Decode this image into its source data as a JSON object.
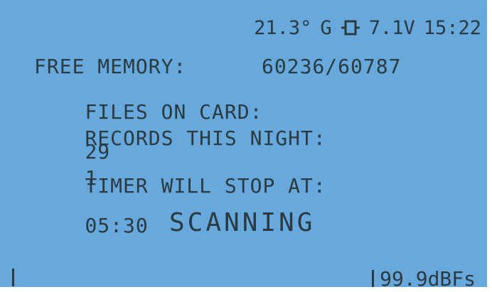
{
  "status": {
    "temperature": "21.3°",
    "mode": "G",
    "battery_icon": "battery-icon",
    "voltage": "7.1V",
    "time": "15:22"
  },
  "info": {
    "free_memory_label": "FREE MEMORY:",
    "free_memory_value": "60236/60787",
    "files_on_card_label": "FILES ON CARD:",
    "files_on_card_value": "29",
    "records_label": "RECORDS THIS NIGHT:",
    "records_value": "1",
    "timer_label": "TIMER WILL STOP AT:",
    "timer_value": "05:30"
  },
  "main": {
    "state_text": "SCANNING"
  },
  "footer": {
    "left_marker": "|",
    "right_marker": "|",
    "level": "99.9dBFs"
  },
  "colors": {
    "screen": "#67a9dc",
    "text": "#2b3a40"
  }
}
